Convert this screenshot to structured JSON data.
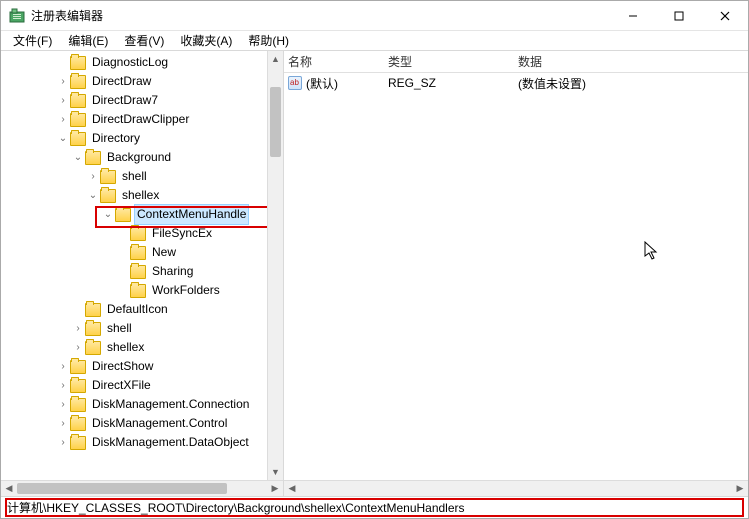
{
  "window": {
    "title": "注册表编辑器"
  },
  "menubar": {
    "items": [
      {
        "label": "文件(F)"
      },
      {
        "label": "编辑(E)"
      },
      {
        "label": "查看(V)"
      },
      {
        "label": "收藏夹(A)"
      },
      {
        "label": "帮助(H)"
      }
    ]
  },
  "tree": {
    "nodes": [
      {
        "indent": 3,
        "expander": "",
        "label": "DiagnosticLog"
      },
      {
        "indent": 3,
        "expander": "›",
        "label": "DirectDraw"
      },
      {
        "indent": 3,
        "expander": "›",
        "label": "DirectDraw7"
      },
      {
        "indent": 3,
        "expander": "›",
        "label": "DirectDrawClipper"
      },
      {
        "indent": 3,
        "expander": "⌄",
        "label": "Directory"
      },
      {
        "indent": 4,
        "expander": "⌄",
        "label": "Background"
      },
      {
        "indent": 5,
        "expander": "›",
        "label": "shell"
      },
      {
        "indent": 5,
        "expander": "⌄",
        "label": "shellex"
      },
      {
        "indent": 6,
        "expander": "⌄",
        "label": "ContextMenuHandle",
        "selected": true
      },
      {
        "indent": 7,
        "expander": "",
        "label": "FileSyncEx"
      },
      {
        "indent": 7,
        "expander": "",
        "label": "New"
      },
      {
        "indent": 7,
        "expander": "",
        "label": "Sharing"
      },
      {
        "indent": 7,
        "expander": "",
        "label": "WorkFolders"
      },
      {
        "indent": 4,
        "expander": "",
        "label": "DefaultIcon"
      },
      {
        "indent": 4,
        "expander": "›",
        "label": "shell"
      },
      {
        "indent": 4,
        "expander": "›",
        "label": "shellex"
      },
      {
        "indent": 3,
        "expander": "›",
        "label": "DirectShow"
      },
      {
        "indent": 3,
        "expander": "›",
        "label": "DirectXFile"
      },
      {
        "indent": 3,
        "expander": "›",
        "label": "DiskManagement.Connection"
      },
      {
        "indent": 3,
        "expander": "›",
        "label": "DiskManagement.Control"
      },
      {
        "indent": 3,
        "expander": "›",
        "label": "DiskManagement.DataObject"
      }
    ]
  },
  "list": {
    "columns": {
      "name": "名称",
      "type": "类型",
      "data": "数据"
    },
    "rows": [
      {
        "name": "(默认)",
        "type": "REG_SZ",
        "data": "(数值未设置)"
      }
    ]
  },
  "statusbar": {
    "path": "计算机\\HKEY_CLASSES_ROOT\\Directory\\Background\\shellex\\ContextMenuHandlers"
  }
}
